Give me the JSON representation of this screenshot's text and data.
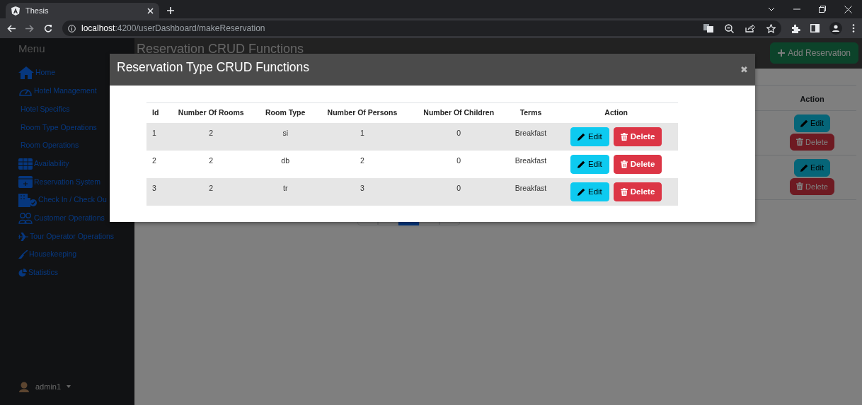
{
  "browser": {
    "tab_title": "Thesis",
    "url": {
      "host": "localhost",
      "path": ":4200/userDashboard/makeReservation"
    }
  },
  "sidebar": {
    "heading": "Menu",
    "items": [
      {
        "label": "Home",
        "kind": "icon"
      },
      {
        "label": "Hotel Management",
        "kind": "icon"
      },
      {
        "label": "Hotel Specifics",
        "kind": "sub"
      },
      {
        "label": "Room Type Operations",
        "kind": "sub"
      },
      {
        "label": "Room Operations",
        "kind": "sub"
      },
      {
        "label": "Availability",
        "kind": "icon"
      },
      {
        "label": "Reservation System",
        "kind": "icon"
      },
      {
        "label": "Check In / Check Ou",
        "kind": "icon"
      },
      {
        "label": "Customer Operations",
        "kind": "icon"
      },
      {
        "label": "Tour Operator Operations",
        "kind": "icon"
      },
      {
        "label": "Housekeeping",
        "kind": "icon"
      },
      {
        "label": "Statistics",
        "kind": "icon"
      }
    ],
    "user": {
      "name": "admin1"
    }
  },
  "page": {
    "title": "Reservation CRUD Functions",
    "add_button": "Add Reservation",
    "table": {
      "action_header": "Action",
      "rows": [
        {
          "edit": "Edit",
          "delete": "Delete"
        },
        {
          "edit": "Edit",
          "delete": "Delete"
        }
      ]
    },
    "pagination": [
      {
        "selected": false
      },
      {
        "selected": false
      },
      {
        "selected": true
      },
      {
        "selected": false
      },
      {
        "selected": false
      }
    ]
  },
  "modal": {
    "title": "Reservation Type CRUD Functions",
    "close": "✖",
    "table": {
      "columns": [
        "Id",
        "Number Of Rooms",
        "Room Type",
        "Number Of Persons",
        "Number Of Children",
        "Terms",
        "Action"
      ],
      "rows": [
        {
          "cells": [
            "1",
            "2",
            "si",
            "1",
            "0",
            "Breakfast"
          ],
          "edit": "Edit",
          "delete": "Delete"
        },
        {
          "cells": [
            "2",
            "2",
            "db",
            "2",
            "0",
            "Breakfast"
          ],
          "edit": "Edit",
          "delete": "Delete"
        },
        {
          "cells": [
            "3",
            "2",
            "tr",
            "3",
            "0",
            "Breakfast"
          ],
          "edit": "Edit",
          "delete": "Delete"
        }
      ]
    }
  }
}
